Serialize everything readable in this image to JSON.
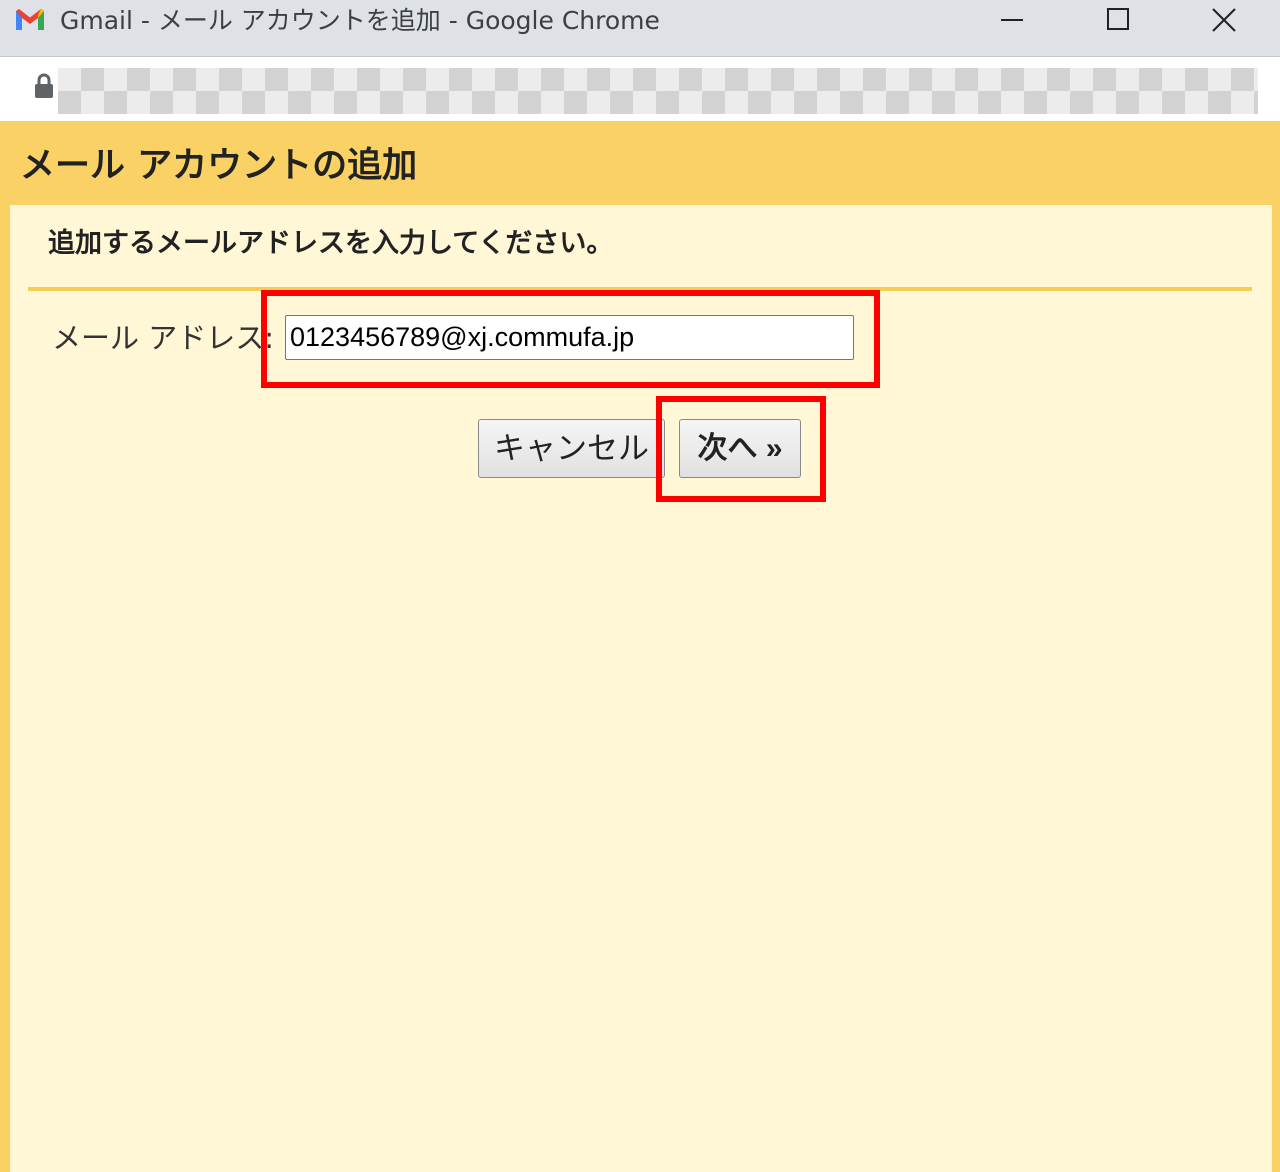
{
  "window": {
    "title": "Gmail - メール アカウントを追加 - Google Chrome",
    "app_icon": "gmail-icon",
    "controls": [
      "minimize-icon",
      "maximize-icon",
      "close-icon"
    ]
  },
  "address_bar": {
    "icon": "lock-icon",
    "url_hidden": true
  },
  "dialog": {
    "title": "メール アカウントの追加",
    "instruction": "追加するメールアドレスを入力してください。",
    "email_label": "メール アドレス:",
    "email_value": "0123456789@xj.commufa.jp",
    "cancel_label": "キャンセル",
    "next_label": "次へ »"
  },
  "colors": {
    "header": "#fad165",
    "body": "#fff7d6",
    "highlight": "#ff0000"
  }
}
